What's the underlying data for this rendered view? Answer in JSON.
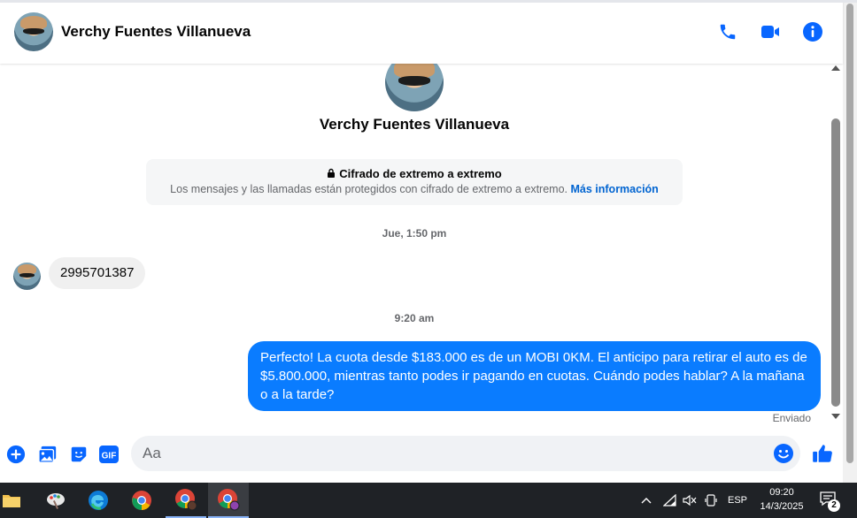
{
  "header": {
    "contact_name": "Verchy Fuentes Villanueva",
    "actions": [
      "phone-icon",
      "video-camera-icon",
      "info-icon"
    ],
    "accent": "#0866ff"
  },
  "profile": {
    "name": "Verchy Fuentes Villanueva"
  },
  "encryption": {
    "title": "Cifrado de extremo a extremo",
    "description": "Los mensajes y las llamadas están protegidos con cifrado de extremo a extremo.",
    "link": "Más información"
  },
  "messages": {
    "timestamp1": "Jue, 1:50 pm",
    "incoming1": "2995701387",
    "timestamp2": "9:20 am",
    "outgoing1": "Perfecto! La cuota desde $183.000 es de un MOBI 0KM. El anticipo para retirar el auto es de $5.800.000, mientras tanto podes ir pagando en cuotas. Cuándo podes hablar? A la mañana o a la tarde?",
    "status": "Enviado",
    "bubble_color": "#0a7cff"
  },
  "composer": {
    "placeholder": "Aa",
    "icons": [
      "plus-circle-icon",
      "gallery-icon",
      "sticker-icon",
      "gif-icon",
      "emoji-icon",
      "thumbs-up-icon"
    ]
  },
  "taskbar": {
    "apps": [
      "file-explorer-icon",
      "paint-icon",
      "edge-icon",
      "chrome-icon",
      "chrome-profile-icon",
      "chrome-profile-active-icon"
    ],
    "language": "ESP",
    "time": "09:20",
    "date": "14/3/2025",
    "notifications": "2"
  }
}
